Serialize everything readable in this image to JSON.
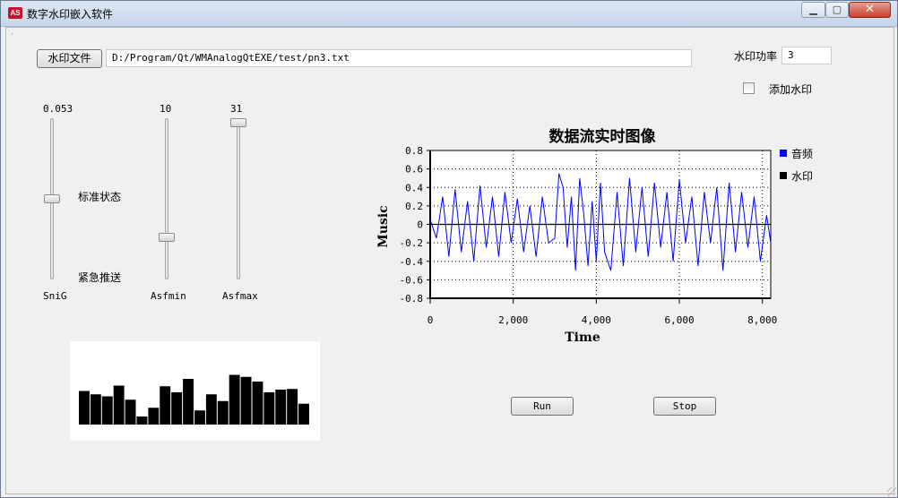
{
  "window": {
    "title": "数字水印嵌入软件",
    "minimize_glyph": "▁",
    "maximize_glyph": "▢",
    "close_glyph": "✕",
    "app_icon_glyph": "AS"
  },
  "toolbar": {
    "open_button_label": "水印文件",
    "file_path": "D:/Program/Qt/WMAnalogQtEXE/test/pn3.txt",
    "power_label": "水印功率",
    "power_value": "3",
    "add_watermark_label": "添加水印",
    "add_watermark_checked": false
  },
  "sliders": [
    {
      "name": "SniG",
      "value_label": "0.053",
      "level": 0.5
    },
    {
      "name": "Asfmin",
      "value_label": "10",
      "level": 0.25
    },
    {
      "name": "Asfmax",
      "value_label": "31",
      "level": 1.0
    }
  ],
  "status": {
    "standard_label": "标准状态",
    "urgent_label": "紧急推送"
  },
  "mini_bar_values": [
    0.5,
    0.45,
    0.42,
    0.58,
    0.37,
    0.12,
    0.25,
    0.57,
    0.48,
    0.68,
    0.21,
    0.45,
    0.35,
    0.74,
    0.71,
    0.64,
    0.48,
    0.52,
    0.53,
    0.31
  ],
  "mini_bar_color": "#000000",
  "chart_data": {
    "type": "line",
    "title": "数据流实时图像",
    "xlabel": "Time",
    "ylabel": "Music",
    "xlim": [
      0,
      8200
    ],
    "ylim": [
      -0.8,
      0.8
    ],
    "xticks": [
      0,
      2000,
      4000,
      6000,
      8000
    ],
    "xtick_labels": [
      "0",
      "2,000",
      "4,000",
      "6,000",
      "8,000"
    ],
    "yticks": [
      0.8,
      0.6,
      0.4,
      0.2,
      0,
      -0.2,
      -0.4,
      -0.6,
      -0.8
    ],
    "ytick_labels": [
      "0.8",
      "0.6",
      "0.4",
      "0.2",
      "0",
      "-0.2",
      "-0.4",
      "-0.6",
      "-0.8"
    ],
    "grid": true,
    "legend_position": "right",
    "series": [
      {
        "name": "音频",
        "color": "#0000ff",
        "x": [
          0,
          150,
          300,
          450,
          600,
          750,
          900,
          1050,
          1200,
          1350,
          1500,
          1650,
          1800,
          1950,
          2100,
          2250,
          2400,
          2550,
          2700,
          2850,
          3000,
          3100,
          3200,
          3300,
          3400,
          3500,
          3600,
          3700,
          3800,
          3900,
          4000,
          4100,
          4200,
          4350,
          4500,
          4650,
          4800,
          4950,
          5100,
          5250,
          5400,
          5550,
          5700,
          5850,
          6000,
          6150,
          6300,
          6450,
          6600,
          6750,
          6900,
          7050,
          7200,
          7350,
          7500,
          7650,
          7800,
          7950,
          8100,
          8200
        ],
        "y": [
          0.05,
          -0.15,
          0.3,
          -0.35,
          0.38,
          -0.3,
          0.25,
          -0.4,
          0.42,
          -0.25,
          0.3,
          -0.35,
          0.35,
          -0.2,
          0.28,
          -0.3,
          0.2,
          -0.35,
          0.3,
          -0.2,
          -0.15,
          0.55,
          0.4,
          -0.25,
          0.3,
          -0.5,
          0.5,
          0.1,
          -0.45,
          0.25,
          -0.4,
          0.45,
          -0.3,
          -0.5,
          0.35,
          -0.45,
          0.5,
          -0.3,
          0.4,
          -0.35,
          0.45,
          -0.25,
          0.35,
          -0.4,
          0.48,
          -0.2,
          0.3,
          -0.45,
          0.35,
          -0.2,
          0.4,
          -0.5,
          0.45,
          -0.3,
          0.35,
          -0.25,
          0.3,
          -0.4,
          0.1,
          -0.2
        ]
      },
      {
        "name": "水印",
        "color": "#000000",
        "x": [
          0,
          8200
        ],
        "y": [
          0,
          0
        ]
      }
    ]
  },
  "actions": {
    "run_label": "Run",
    "stop_label": "Stop"
  }
}
